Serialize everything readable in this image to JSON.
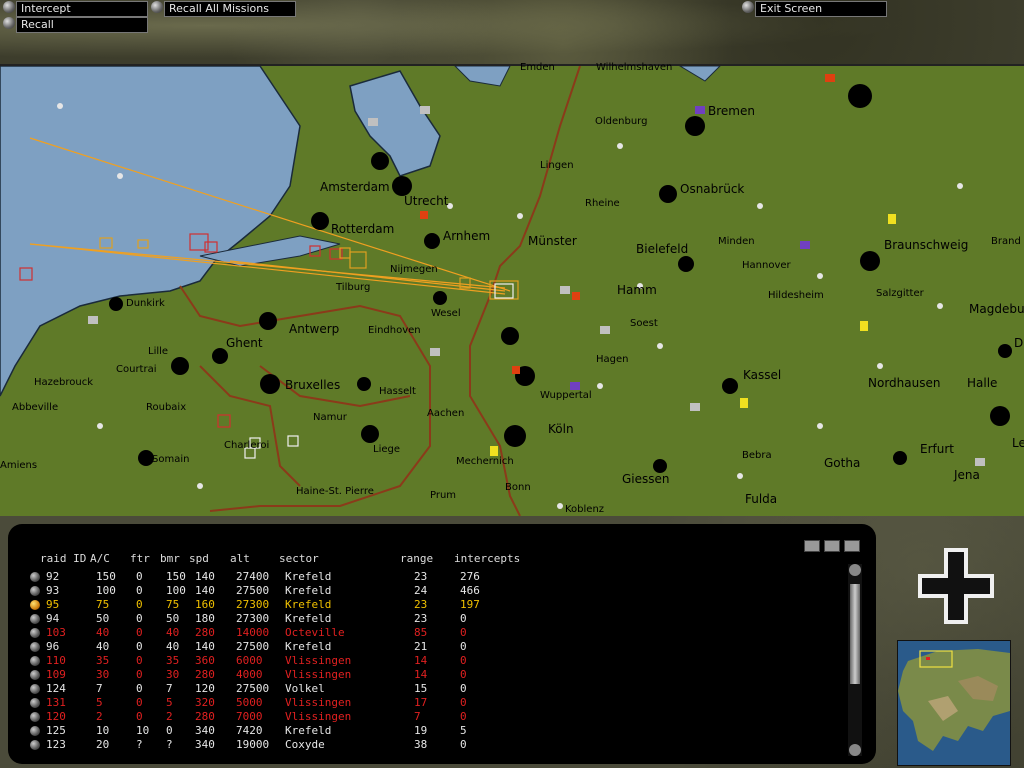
{
  "top_buttons": {
    "intercept": "Intercept",
    "recall": "Recall",
    "recall_all": "Recall All Missions",
    "exit": "Exit Screen"
  },
  "map": {
    "cities": [
      "Amsterdam",
      "Utrecht",
      "Rotterdam",
      "Arnhem",
      "Nijmegen",
      "Tilburg",
      "Eindhoven",
      "Wesel",
      "Antwerp",
      "Ghent",
      "Dunkirk",
      "Lille",
      "Courtrai",
      "Hazebrouck",
      "Abbeville",
      "Roubaix",
      "Bruxelles",
      "Hasselt",
      "Aachen",
      "Namur",
      "Liege",
      "Charleroi",
      "Somain",
      "Amiens",
      "Haine-St. Pierre",
      "Prum",
      "Bonn",
      "Koblenz",
      "Mechernich",
      "Köln",
      "Wuppertal",
      "Hagen",
      "Soest",
      "Hamm",
      "Münster",
      "Rheine",
      "Lingen",
      "Oldenburg",
      "Bremen",
      "Osnabrück",
      "Emden",
      "Wilhelmshaven",
      "Bielefeld",
      "Minden",
      "Hannover",
      "Hildesheim",
      "Salzgitter",
      "Braunschweig",
      "Brand",
      "Magdebu",
      "Kassel",
      "Nordhausen",
      "Halle",
      "Erfurt",
      "Gotha",
      "Jena",
      "Bebra",
      "Giessen",
      "Fulda",
      "D",
      "Le"
    ]
  },
  "table": {
    "headers": {
      "raid_id": "raid ID",
      "ac": "A/C",
      "ftr": "ftr",
      "bmr": "bmr",
      "spd": "spd",
      "alt": "alt",
      "sector": "sector",
      "range": "range",
      "intercepts": "intercepts"
    },
    "colors": {
      "normal": "#e6e6e6",
      "selected": "#f0c000",
      "hostile": "#e02020"
    },
    "rows": [
      {
        "raid_id": "92",
        "ac": "150",
        "ftr": "0",
        "bmr": "150",
        "spd": "140",
        "alt": "27400",
        "sector": "Krefeld",
        "range": "23",
        "intercepts": "276",
        "state": "normal"
      },
      {
        "raid_id": "93",
        "ac": "100",
        "ftr": "0",
        "bmr": "100",
        "spd": "140",
        "alt": "27500",
        "sector": "Krefeld",
        "range": "24",
        "intercepts": "466",
        "state": "normal"
      },
      {
        "raid_id": "95",
        "ac": "75",
        "ftr": "0",
        "bmr": "75",
        "spd": "160",
        "alt": "27300",
        "sector": "Krefeld",
        "range": "23",
        "intercepts": "197",
        "state": "selected"
      },
      {
        "raid_id": "94",
        "ac": "50",
        "ftr": "0",
        "bmr": "50",
        "spd": "180",
        "alt": "27300",
        "sector": "Krefeld",
        "range": "23",
        "intercepts": "0",
        "state": "normal"
      },
      {
        "raid_id": "103",
        "ac": "40",
        "ftr": "0",
        "bmr": "40",
        "spd": "280",
        "alt": "14000",
        "sector": "Octeville",
        "range": "85",
        "intercepts": "0",
        "state": "hostile"
      },
      {
        "raid_id": "96",
        "ac": "40",
        "ftr": "0",
        "bmr": "40",
        "spd": "140",
        "alt": "27500",
        "sector": "Krefeld",
        "range": "21",
        "intercepts": "0",
        "state": "normal"
      },
      {
        "raid_id": "110",
        "ac": "35",
        "ftr": "0",
        "bmr": "35",
        "spd": "360",
        "alt": "6000",
        "sector": "Vlissingen",
        "range": "14",
        "intercepts": "0",
        "state": "hostile"
      },
      {
        "raid_id": "109",
        "ac": "30",
        "ftr": "0",
        "bmr": "30",
        "spd": "280",
        "alt": "4000",
        "sector": "Vlissingen",
        "range": "14",
        "intercepts": "0",
        "state": "hostile"
      },
      {
        "raid_id": "124",
        "ac": "7",
        "ftr": "0",
        "bmr": "7",
        "spd": "120",
        "alt": "27500",
        "sector": "Volkel",
        "range": "15",
        "intercepts": "0",
        "state": "normal"
      },
      {
        "raid_id": "131",
        "ac": "5",
        "ftr": "0",
        "bmr": "5",
        "spd": "320",
        "alt": "5000",
        "sector": "Vlissingen",
        "range": "17",
        "intercepts": "0",
        "state": "hostile"
      },
      {
        "raid_id": "120",
        "ac": "2",
        "ftr": "0",
        "bmr": "2",
        "spd": "280",
        "alt": "7000",
        "sector": "Vlissingen",
        "range": "7",
        "intercepts": "0",
        "state": "hostile"
      },
      {
        "raid_id": "125",
        "ac": "10",
        "ftr": "10",
        "bmr": "0",
        "spd": "340",
        "alt": "7420",
        "sector": "Krefeld",
        "range": "19",
        "intercepts": "5",
        "state": "normal"
      },
      {
        "raid_id": "123",
        "ac": "20",
        "ftr": "?",
        "bmr": "?",
        "spd": "340",
        "alt": "19000",
        "sector": "Coxyde",
        "range": "38",
        "intercepts": "0",
        "state": "normal"
      }
    ]
  },
  "icons": {
    "cross": "balkenkreuz-icon",
    "minimap": "europe-minimap"
  }
}
